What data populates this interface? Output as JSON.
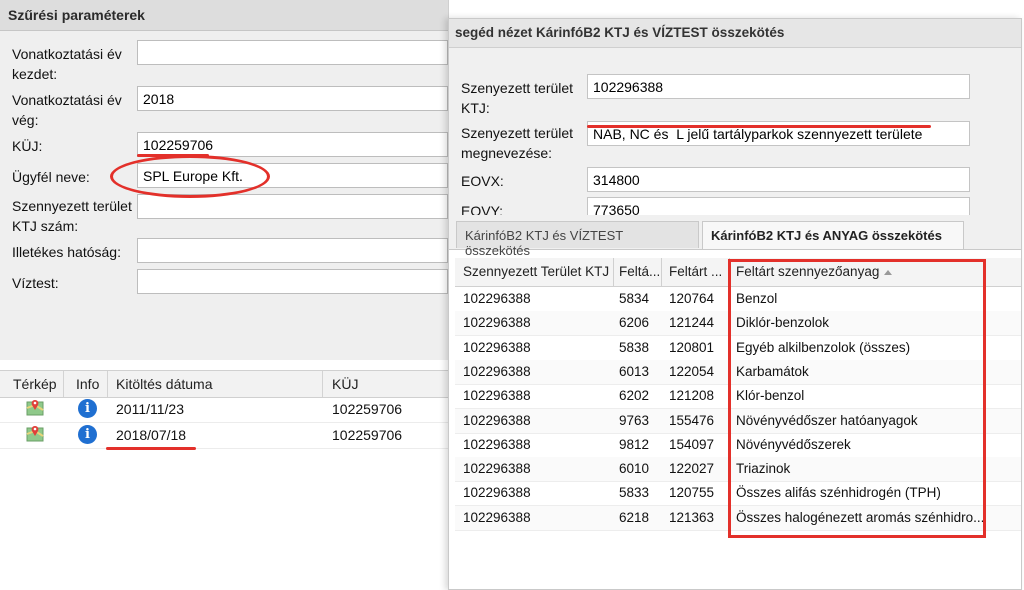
{
  "filter_panel": {
    "title": "Szűrési paraméterek",
    "fields": [
      {
        "label": "Vonatkoztatási év kezdet:",
        "value": ""
      },
      {
        "label": "Vonatkoztatási év vég:",
        "value": "2018"
      },
      {
        "label": "KÜJ:",
        "value": "102259706"
      },
      {
        "label": "Ügyfél neve:",
        "value": "SPL Europe Kft."
      },
      {
        "label": "Szennyezett terület KTJ szám:",
        "value": ""
      },
      {
        "label": "Illetékes hatóság:",
        "value": ""
      },
      {
        "label": "Víztest:",
        "value": ""
      }
    ]
  },
  "left_grid": {
    "columns": [
      "Térkép",
      "Info",
      "Kitöltés dátuma",
      "KÜJ"
    ],
    "rows": [
      {
        "date": "2011/11/23",
        "kuj": "102259706",
        "info_glyph": "i"
      },
      {
        "date": "2018/07/18",
        "kuj": "102259706",
        "info_glyph": "i"
      }
    ],
    "icons": [
      "map-icon",
      "info-icon"
    ]
  },
  "detail_window": {
    "title": "segéd nézet KárinfóB2 KTJ és VÍZTEST összekötés",
    "fields": [
      {
        "label": "Szenyezett terület KTJ:",
        "value": "102296388"
      },
      {
        "label": "Szenyezett terület megnevezése:",
        "value": "NAB, NC és  L jelű tartályparkok szennyezett területe"
      },
      {
        "label": "EOVX:",
        "value": "314800"
      },
      {
        "label": "EOVY:",
        "value": "773650"
      }
    ],
    "tabs": [
      {
        "label": "KárinfóB2 KTJ és VÍZTEST összekötés",
        "active": false
      },
      {
        "label": "KárinfóB2 KTJ és ANYAG összekötés",
        "active": true
      }
    ],
    "grid": {
      "columns": [
        "Szennyezett Terület KTJ",
        "Feltá...",
        "Feltárt ...",
        "Feltárt szennyezőanyag"
      ],
      "rows": [
        {
          "ktj": "102296388",
          "a": "5834",
          "b": "120764",
          "anyag": "Benzol"
        },
        {
          "ktj": "102296388",
          "a": "6206",
          "b": "121244",
          "anyag": "Diklór-benzolok"
        },
        {
          "ktj": "102296388",
          "a": "5838",
          "b": "120801",
          "anyag": "Egyéb alkilbenzolok (összes)"
        },
        {
          "ktj": "102296388",
          "a": "6013",
          "b": "122054",
          "anyag": "Karbamátok"
        },
        {
          "ktj": "102296388",
          "a": "6202",
          "b": "121208",
          "anyag": "Klór-benzol"
        },
        {
          "ktj": "102296388",
          "a": "9763",
          "b": "155476",
          "anyag": "Növényvédőszer hatóanyagok"
        },
        {
          "ktj": "102296388",
          "a": "9812",
          "b": "154097",
          "anyag": "Növényvédőszerek"
        },
        {
          "ktj": "102296388",
          "a": "6010",
          "b": "122027",
          "anyag": "Triazinok"
        },
        {
          "ktj": "102296388",
          "a": "5833",
          "b": "120755",
          "anyag": "Összes alifás szénhidrogén (TPH)"
        },
        {
          "ktj": "102296388",
          "a": "6218",
          "b": "121363",
          "anyag": "Összes halogénezett aromás szénhidro..."
        }
      ]
    }
  },
  "colors": {
    "annotation_red": "#e3302a",
    "info_blue": "#1f6fd1"
  }
}
